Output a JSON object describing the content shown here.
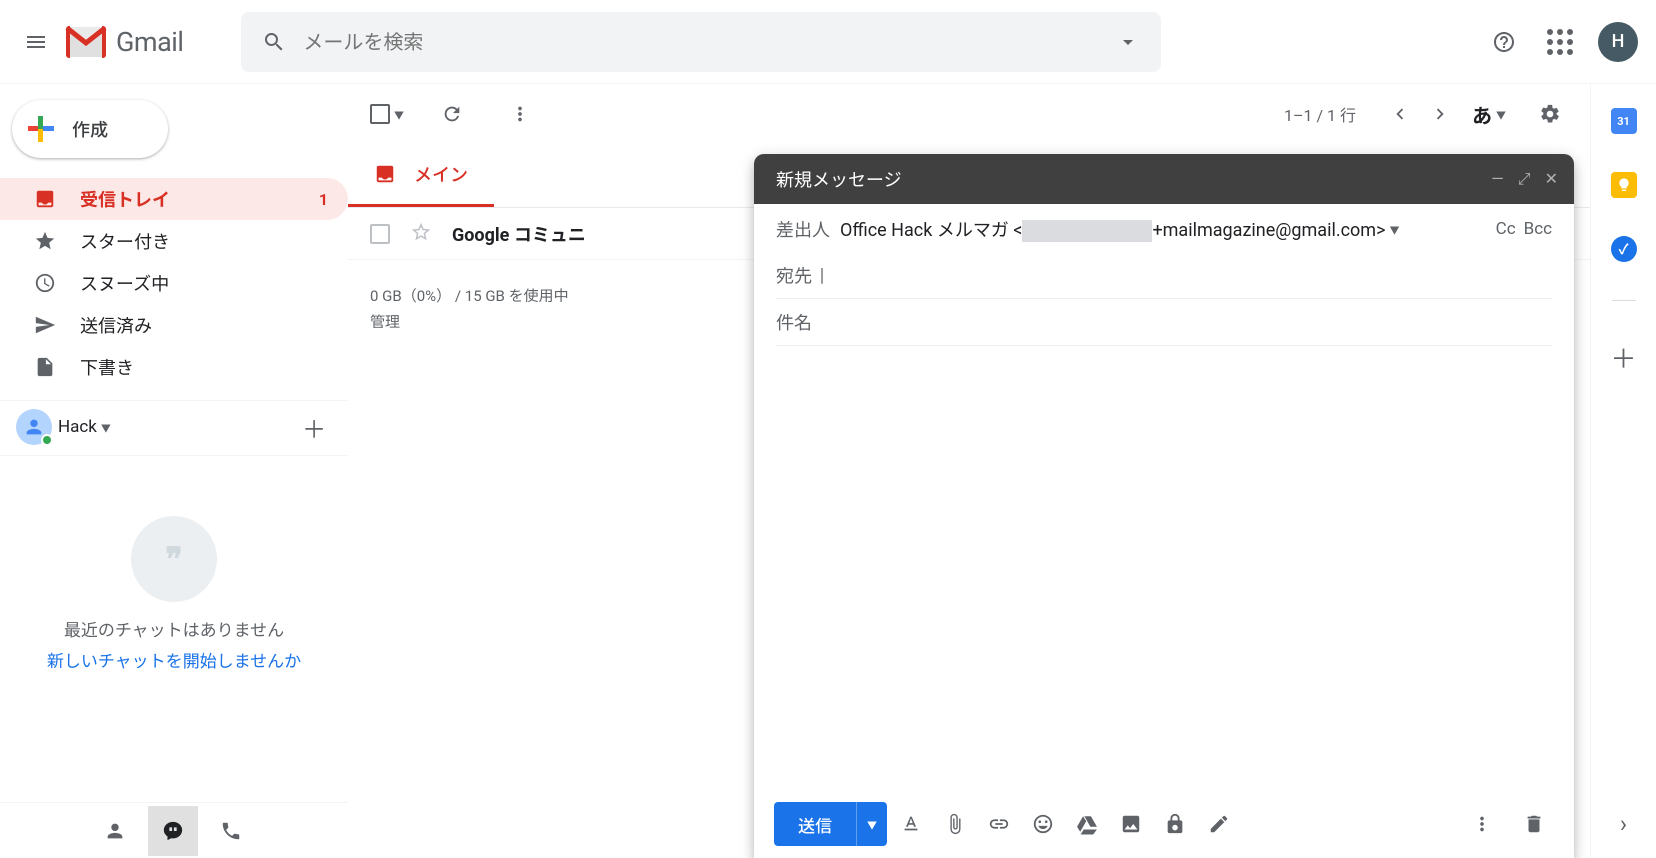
{
  "header": {
    "logo_text": "Gmail",
    "search_placeholder": "メールを検索",
    "avatar_letter": "H"
  },
  "compose_button": "作成",
  "nav": {
    "inbox": {
      "label": "受信トレイ",
      "count": "1"
    },
    "starred": {
      "label": "スター付き"
    },
    "snoozed": {
      "label": "スヌーズ中"
    },
    "sent": {
      "label": "送信済み"
    },
    "drafts": {
      "label": "下書き"
    }
  },
  "chat": {
    "name": "Hack"
  },
  "hangouts": {
    "line1": "最近のチャットはありません",
    "line2": "新しいチャットを開始しませんか"
  },
  "toolbar": {
    "page_counter": "1–1 / 1 行",
    "lang": "あ"
  },
  "tabs": {
    "primary": "メイン"
  },
  "mail": {
    "row0_sender": "Google コミュニ"
  },
  "storage": {
    "line1": "0 GB（0%） / 15 GB を使用中",
    "line2": "管理"
  },
  "side_panel": {
    "calendar_day": "31"
  },
  "compose_window": {
    "title": "新規メッセージ",
    "from_label": "差出人",
    "from_name": "Office Hack メルマガ <",
    "from_tail": "+mailmagazine@gmail.com>",
    "cc": "Cc",
    "bcc": "Bcc",
    "to_label": "宛先",
    "subject_placeholder": "件名",
    "send_label": "送信"
  }
}
